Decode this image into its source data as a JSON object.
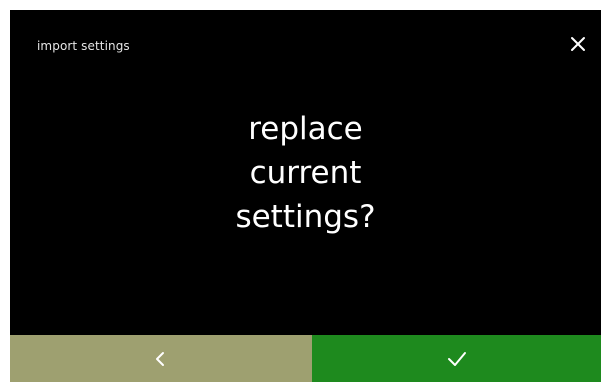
{
  "header": {
    "title": "import settings",
    "close_icon": "close-icon"
  },
  "dialog": {
    "lines": [
      "replace",
      "current",
      "settings?"
    ]
  },
  "footer": {
    "back_icon": "chevron-left-icon",
    "confirm_icon": "checkmark-icon",
    "colors": {
      "back": "#9ea070",
      "confirm": "#1e8a1e",
      "screen": "#000000"
    }
  }
}
